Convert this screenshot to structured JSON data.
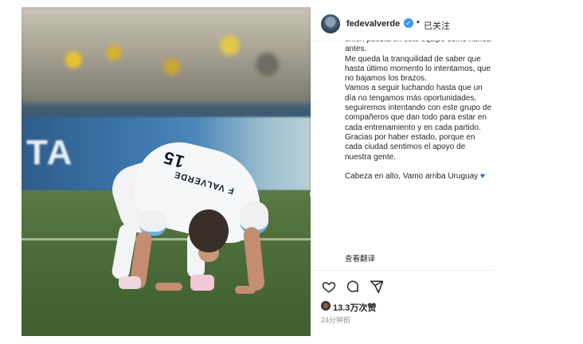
{
  "photo": {
    "board_text": "TA",
    "shirt_number": "15",
    "shirt_name": "F VALVERDE"
  },
  "nav": {
    "next_symbol": "›"
  },
  "post": {
    "username": "fedevalverde",
    "separator": "•",
    "follow_status": "已关注",
    "caption_lines": [
      "unión puesta en este equipo como nunca antes.",
      "Me queda la tranquilidad de saber que hasta último momento lo intentamos, que no bajamos los brazos.",
      "Vamos a seguir luchando hasta que un día no tengamos más oportunidades, seguiremos intentando con este grupo de compañeros que dan todo para estar en cada entrenamiento y en cada partido.",
      "Gracias por haber estado, porque en cada ciudad sentimos el apoyo de nuestra gente.",
      "",
      "Cabeza en alto, Vamo arriba Uruguay"
    ],
    "translate_label": "查看翻译",
    "likes": "13.3万次赞",
    "time": "24分钟前"
  },
  "colors": {
    "verified": "#3897f0",
    "heart": "#1f66d6",
    "link": "#262626"
  },
  "icons": [
    "heart-icon",
    "comment-icon",
    "share-icon",
    "verified-badge-icon",
    "blue-heart-emoji-icon"
  ]
}
